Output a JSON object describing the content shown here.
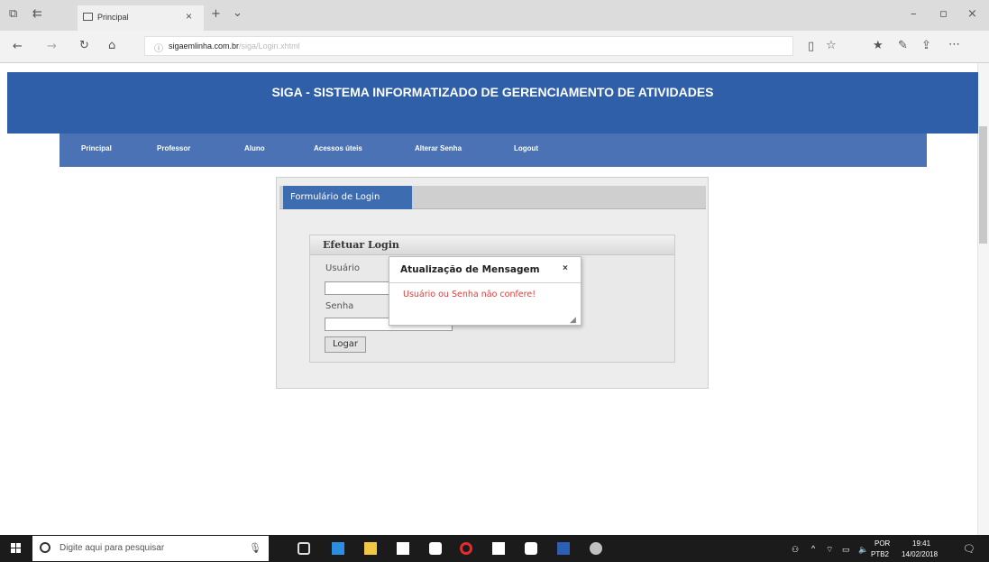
{
  "browser": {
    "tab_title": "Principal",
    "url_domain": "sigaemlinha.com.br",
    "url_path": "/siga/Login.xhtml"
  },
  "header": {
    "title": "SIGA - SISTEMA INFORMATIZADO DE GERENCIAMENTO DE ATIVIDADES"
  },
  "nav": {
    "items": [
      "Principal",
      "Professor",
      "Aluno",
      "Acessos úteis",
      "Alterar Senha",
      "Logout"
    ]
  },
  "panel": {
    "tab_label": "Formulário de Login",
    "fieldset_title": "Efetuar Login",
    "username_label": "Usuário",
    "password_label": "Senha",
    "login_button": "Logar"
  },
  "dialog": {
    "title": "Atualização de Mensagem",
    "close": "×",
    "message": "Usuário ou Senha não confere!"
  },
  "taskbar": {
    "search_placeholder": "Digite aqui para pesquisar",
    "lang_top": "POR",
    "lang_bottom": "PTB2",
    "time": "19:41",
    "date": "14/02/2018"
  },
  "colors": {
    "header_bg": "#2e5fa8",
    "nav_bg": "#4a72b4",
    "error_text": "#e23a3a"
  }
}
